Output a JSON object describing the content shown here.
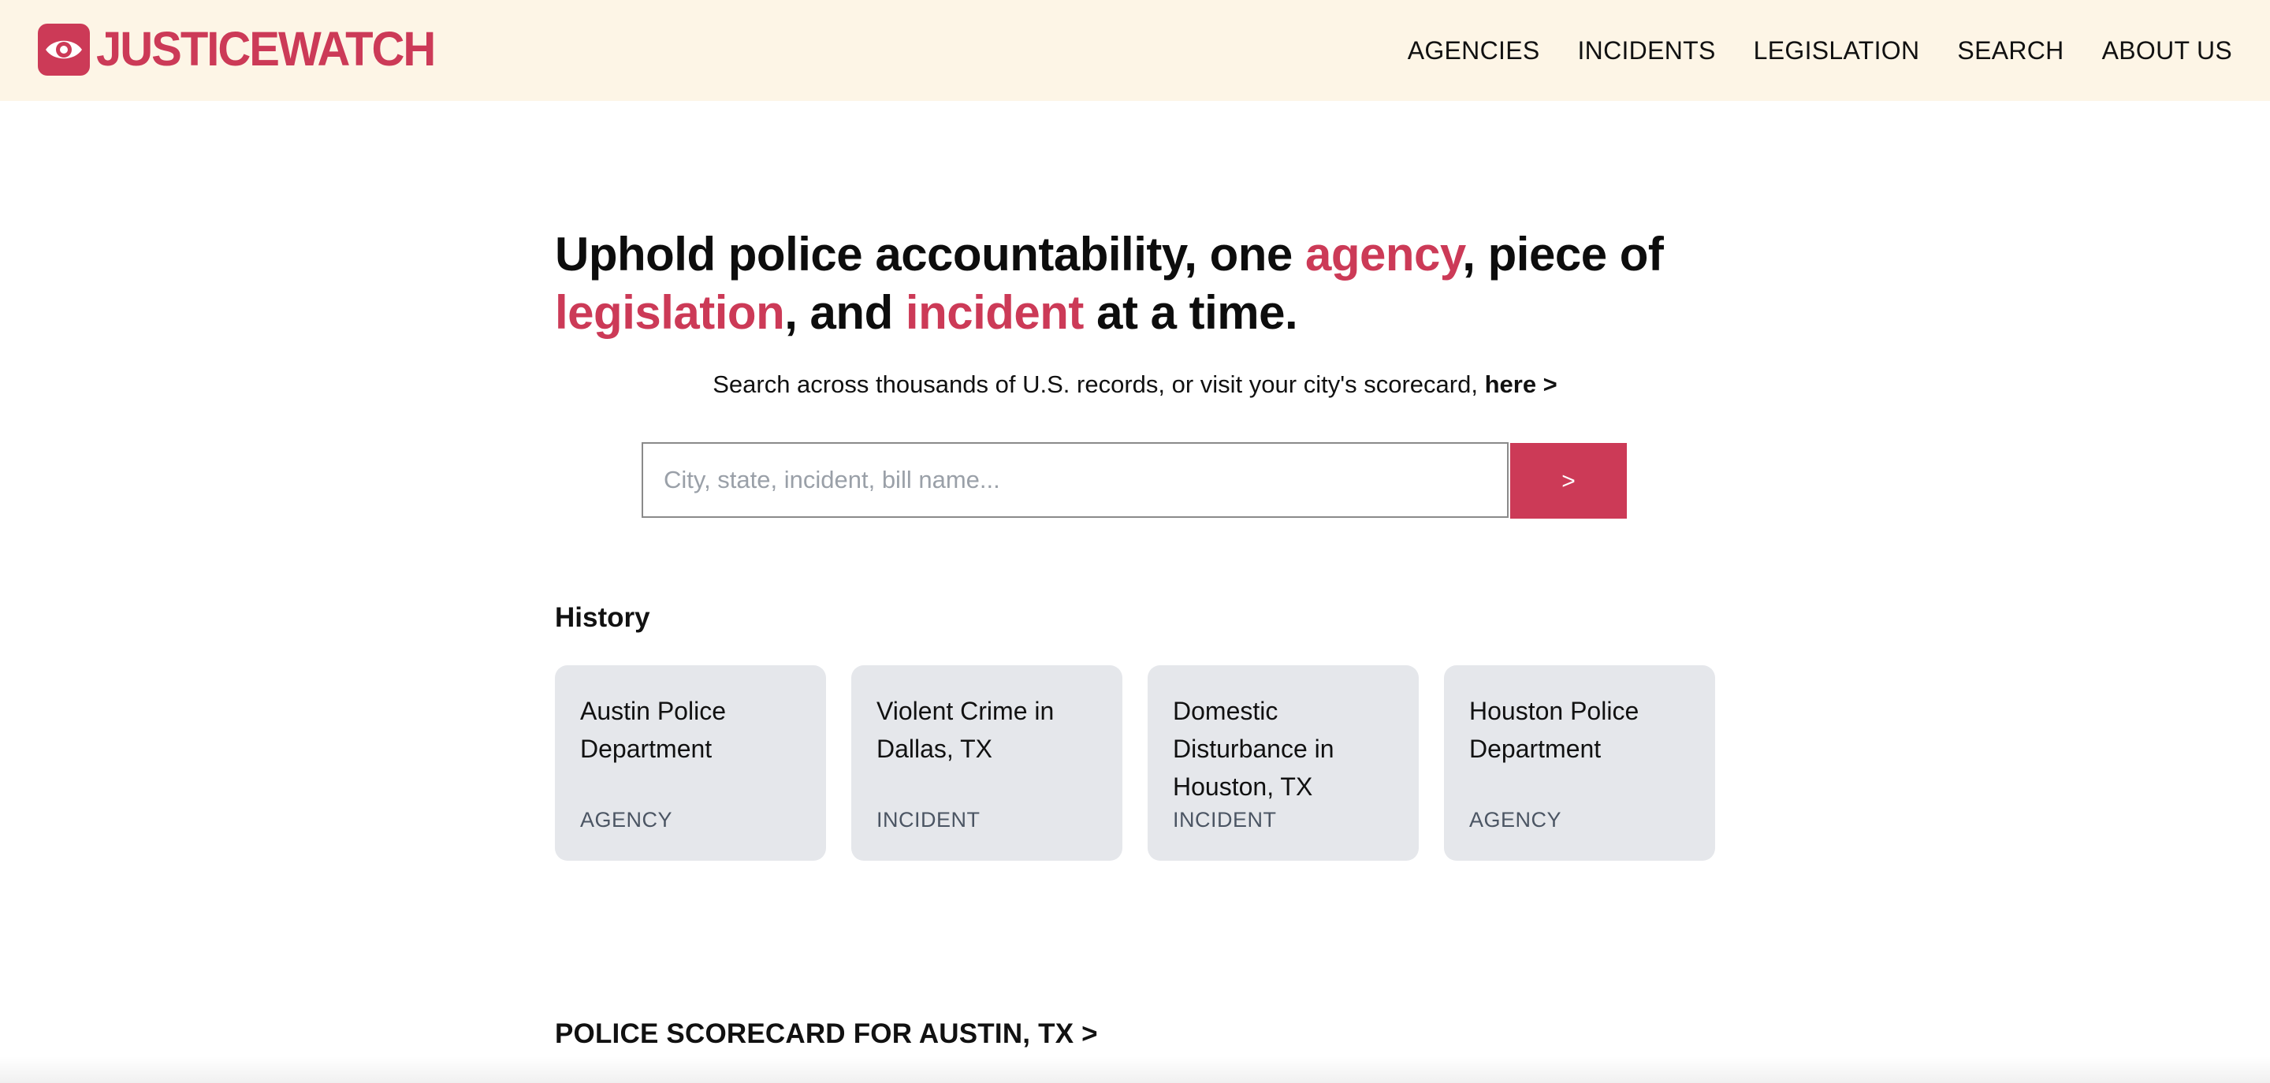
{
  "header": {
    "logo_text": "JUSTICEWATCH",
    "nav": [
      "AGENCIES",
      "INCIDENTS",
      "LEGISLATION",
      "SEARCH",
      "ABOUT US"
    ]
  },
  "hero": {
    "part1": "Uphold police accountability, one ",
    "hl1": "agency",
    "part2": ", piece of ",
    "hl2": "legislation",
    "part3": ", and ",
    "hl3": "incident",
    "part4": " at a time."
  },
  "subline": {
    "text": "Search across thousands of U.S. records, or visit your city's scorecard, ",
    "link": "here >"
  },
  "search": {
    "placeholder": "City, state, incident, bill name...",
    "value": "",
    "button_label": ">"
  },
  "history": {
    "title": "History",
    "items": [
      {
        "title": "Austin Police Department",
        "type": "AGENCY"
      },
      {
        "title": "Violent Crime in Dallas, TX",
        "type": "INCIDENT"
      },
      {
        "title": "Domestic Disturbance in Houston, TX",
        "type": "INCIDENT"
      },
      {
        "title": "Houston Police Department",
        "type": "AGENCY"
      }
    ]
  },
  "scorecard_link": "POLICE SCORECARD FOR AUSTIN, TX >",
  "colors": {
    "accent": "#cc3a57",
    "header_bg": "#fdf5e6",
    "card_bg": "#e5e7eb"
  },
  "icons": {
    "logo": "eye-icon"
  }
}
